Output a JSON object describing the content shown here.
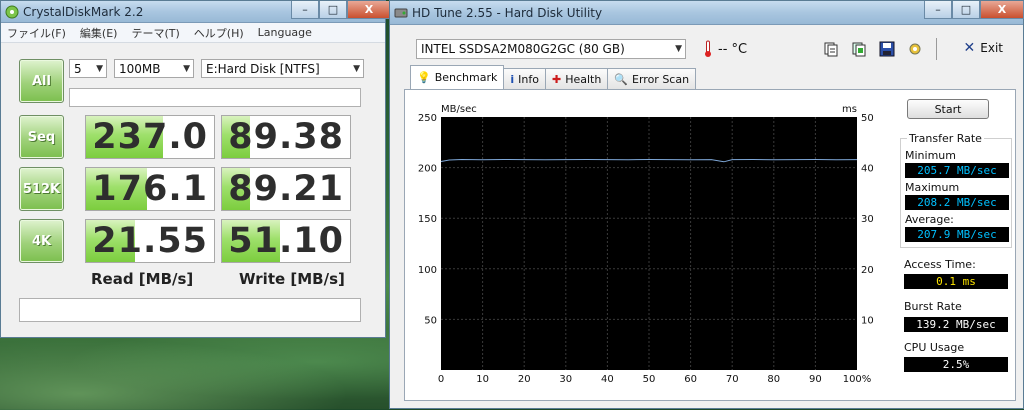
{
  "cdm": {
    "title": "CrystalDiskMark 2.2",
    "window_buttons": [
      "–",
      "□",
      "X"
    ],
    "menu": [
      "ファイル(F)",
      "編集(E)",
      "テーマ(T)",
      "ヘルプ(H)",
      "Language"
    ],
    "runs": "5",
    "size": "100MB",
    "drive": "E:Hard Disk [NTFS]",
    "all_label": "All",
    "rows": [
      {
        "label": "Seq",
        "read": "237.0",
        "write": "89.38",
        "read_fraction": 0.6,
        "write_fraction": 0.22
      },
      {
        "label": "512K",
        "read": "176.1",
        "write": "89.21",
        "read_fraction": 0.48,
        "write_fraction": 0.22
      },
      {
        "label": "4K",
        "read": "21.55",
        "write": "51.10",
        "read_fraction": 0.38,
        "write_fraction": 0.45
      }
    ],
    "read_header": "Read [MB/s]",
    "write_header": "Write [MB/s]"
  },
  "hdt": {
    "title": "HD Tune 2.55 - Hard Disk Utility",
    "window_buttons": [
      "–",
      "□",
      "X"
    ],
    "drive": "INTEL SSDSA2M080G2GC (80 GB)",
    "temperature": "-- °C",
    "exit_label": "Exit",
    "tabs": [
      "Benchmark",
      "Info",
      "Health",
      "Error Scan"
    ],
    "start_label": "Start",
    "transfer_rate_title": "Transfer Rate",
    "minimum_label": "Minimum",
    "minimum_value": "205.7 MB/sec",
    "maximum_label": "Maximum",
    "maximum_value": "208.2 MB/sec",
    "average_label": "Average:",
    "average_value": "207.9 MB/sec",
    "access_time_label": "Access Time:",
    "access_time_value": "0.1 ms",
    "burst_rate_label": "Burst Rate",
    "burst_rate_value": "139.2 MB/sec",
    "cpu_usage_label": "CPU Usage",
    "cpu_usage_value": "2.5%"
  },
  "chart_data": {
    "type": "line",
    "ylabel": "MB/sec",
    "y2label": "ms",
    "ylim": [
      0,
      250
    ],
    "y2lim": [
      0,
      50
    ],
    "yticks": [
      0,
      50,
      100,
      150,
      200,
      250
    ],
    "y2ticks": [
      10,
      20,
      30,
      40,
      50
    ],
    "xticks": [
      "0",
      "10",
      "20",
      "30",
      "40",
      "50",
      "60",
      "70",
      "80",
      "90",
      "100%"
    ],
    "xlim": [
      0,
      100
    ],
    "grid": true,
    "series": [
      {
        "x": [
          0,
          2,
          5,
          10,
          15,
          20,
          25,
          30,
          35,
          40,
          45,
          50,
          55,
          60,
          65,
          68,
          70,
          75,
          80,
          85,
          90,
          95,
          100
        ],
        "values": [
          206,
          207.5,
          208,
          207.8,
          208,
          207.9,
          207.8,
          207.9,
          208,
          207.9,
          207.8,
          208,
          207.9,
          207.8,
          207.9,
          205.7,
          207.9,
          208,
          207.8,
          207.9,
          208,
          207.8,
          207.9
        ],
        "color": "#7fa8d8"
      }
    ]
  }
}
